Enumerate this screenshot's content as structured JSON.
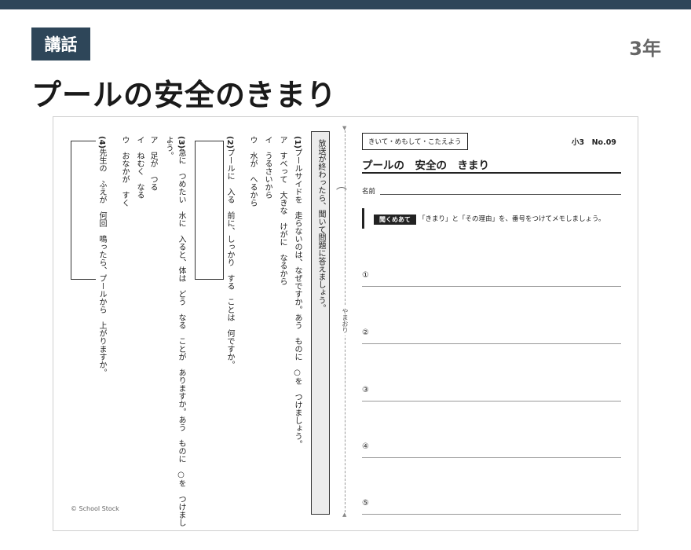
{
  "header": {
    "badge": "講話",
    "grade": "3年",
    "title": "プールの安全のきまり"
  },
  "worksheet_right": {
    "tag": "きいて・めもして・こたえよう",
    "code": "小3　No.09",
    "title": "プールの　安全の　きまり",
    "name_label": "名前",
    "listen_tag": "聞くめあて",
    "listen_text": "「きまり」と「その理由」を、番号をつけてメモしましょう。",
    "memo_rows": [
      "①",
      "②",
      "③",
      "④",
      "⑤"
    ]
  },
  "worksheet_left": {
    "instruction": "放送が終わったら、聞いて問題に答えましょう。",
    "q1": {
      "number": "(1)",
      "text": "プールサイドを　走らないのは、なぜですか。あう　ものに　○を　つけましょう。",
      "options": [
        "ア　すべって　大きな　けがに　なるから",
        "イ　うるさいから",
        "ウ　水が　へるから"
      ]
    },
    "q2": {
      "number": "(2)",
      "text": "プールに　入る　前に、しっかり　する　ことは　何ですか。"
    },
    "q3": {
      "number": "(3)",
      "text": "急に　つめたい　水に　入ると、体は　どう　なる　ことが　ありますか。あう　ものに　○を　つけまし",
      "text_cont": "よう。",
      "options": [
        "ア　足が　つる",
        "イ　ねむく　なる",
        "ウ　おなかが　すく"
      ]
    },
    "q4": {
      "number": "(4)",
      "text": "先生の　ふえが　何回　鳴ったら、プールから　上がりますか。"
    },
    "fold_label": "やまおり",
    "copyright": "© School Stock"
  }
}
